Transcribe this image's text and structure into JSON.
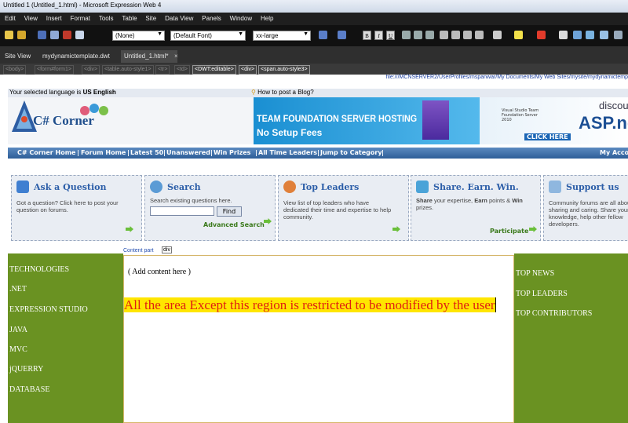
{
  "window": {
    "title": "Untitled 1 (Untitled_1.html) - Microsoft Expression Web 4"
  },
  "menu": [
    "Edit",
    "View",
    "Insert",
    "Format",
    "Tools",
    "Table",
    "Site",
    "Data View",
    "Panels",
    "Window",
    "Help"
  ],
  "toolbar": {
    "style_select": "(None)",
    "font_select": "(Default Font)",
    "size_select": "xx-large",
    "bold": "B",
    "italic": "I",
    "underline": "U"
  },
  "tabs": [
    {
      "label": "Site View"
    },
    {
      "label": "mydynamictemplate.dwt"
    },
    {
      "label": "Untitled_1.html*"
    }
  ],
  "tab_close": "×",
  "breadcrumb": [
    "<body>",
    "<form#form1>",
    "<div>",
    "<table.auto-style1>",
    "<tr>",
    "<td>",
    "<DWT:editable>",
    "<div>",
    "<span.auto-style3>"
  ],
  "page": {
    "file_path": "file:///MCNSERVER2/UserProfiles/mspanwar/My Documents/My Web Sites/mysite/mydynamictemp",
    "language_prefix": "Your selected language is ",
    "language": "US English",
    "how_to_post": "How to post a Blog?",
    "logo": "C# Corner",
    "banner": {
      "line1": "TEAM FOUNDATION SERVER HOSTING",
      "line2": "No Setup Fees",
      "click": "CLICK HERE",
      "discount": "discount",
      "asp": "ASP.ne",
      "vs": "Visual Studio Team Foundation Server 2010"
    },
    "nav_items": [
      "C# Corner Home",
      "Forum Home",
      "Latest 50",
      "Unanswered",
      "Win Prizes",
      "All Time Leaders",
      "Jump to Category"
    ],
    "nav_right": "My Acco",
    "boxes": [
      {
        "title": "Ask a Question",
        "desc": "Got a question? Click here to post your question on forums."
      },
      {
        "title": "Search",
        "desc": "Search existing questions here.",
        "button": "Find",
        "link": "Advanced Search"
      },
      {
        "title": "Top Leaders",
        "desc": "View list of top leaders who have dedicated their time and expertise to help community."
      },
      {
        "title": "Share. Earn. Win.",
        "desc_bold1": "Share",
        "desc1": " your expertise, ",
        "desc_bold2": "Earn",
        "desc2": " points &",
        "desc_bold3": "Win",
        "desc3": " prizes.",
        "link": "Participate"
      },
      {
        "title": "Support us",
        "desc": "Community forums are all about sharing and caring. Share your knowledge, help other fellow developers."
      }
    ],
    "left_links": [
      "TECHNOLOGIES",
      ".NET",
      "EXPRESSION STUDIO",
      "JAVA",
      "MVC",
      "jQUERRY",
      "DATABASE"
    ],
    "right_links": [
      "TOP NEWS",
      "TOP LEADERS",
      "TOP CONTRIBUTORS"
    ],
    "content_tag": "Content part",
    "div_tag": "div",
    "add_content": "( Add content here )",
    "warning": "All the area Except this region is restricted to be modified by the user"
  },
  "colors": {
    "nav": "#2e5e98",
    "green": "#6a9222",
    "warning_text": "#e02010",
    "highlight": "#ffe600"
  }
}
